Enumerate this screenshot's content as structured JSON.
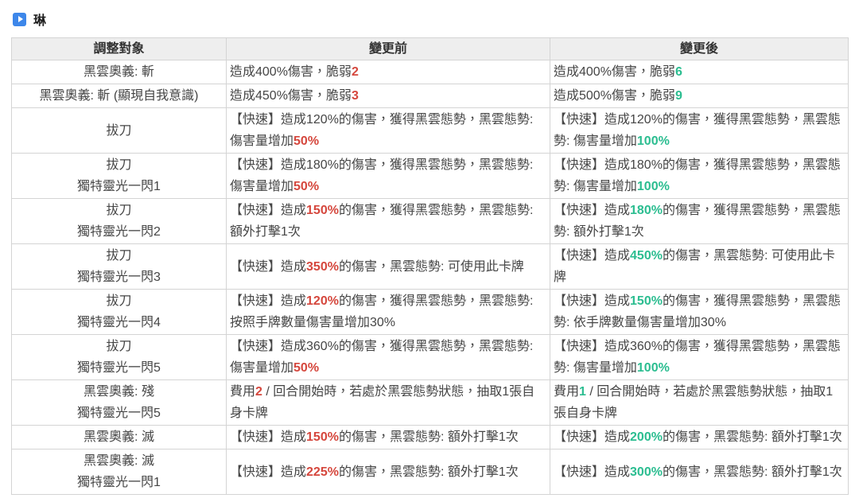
{
  "colors": {
    "accent_blue": "#3d87ea",
    "red": "#d5473d",
    "green": "#2bbd90",
    "header_bg": "#eeeeee",
    "border": "#d4d4d4"
  },
  "section": {
    "icon": "play-icon",
    "title": "琳"
  },
  "table": {
    "headers": [
      "調整對象",
      "變更前",
      "變更後"
    ],
    "rows": [
      {
        "target": [
          "黑雲奧義: 斬"
        ],
        "before": [
          {
            "t": "造成400%傷害，脆弱"
          },
          {
            "t": "2",
            "c": "red"
          }
        ],
        "after": [
          {
            "t": "造成400%傷害，脆弱"
          },
          {
            "t": "6",
            "c": "green"
          }
        ]
      },
      {
        "target": [
          "黑雲奧義: 斬 (顯現自我意識)"
        ],
        "before": [
          {
            "t": "造成450%傷害，脆弱"
          },
          {
            "t": "3",
            "c": "red"
          }
        ],
        "after": [
          {
            "t": "造成500%傷害，脆弱"
          },
          {
            "t": "9",
            "c": "green"
          }
        ]
      },
      {
        "target": [
          "拔刀"
        ],
        "before": [
          {
            "t": "【快速】造成120%的傷害，獲得黑雲態勢，黑雲態勢: 傷害量增加"
          },
          {
            "t": "50%",
            "c": "red"
          }
        ],
        "after": [
          {
            "t": "【快速】造成120%的傷害，獲得黑雲態勢，黑雲態勢: 傷害量增加"
          },
          {
            "t": "100%",
            "c": "green"
          }
        ]
      },
      {
        "target": [
          "拔刀",
          "獨特靈光一閃1"
        ],
        "before": [
          {
            "t": "【快速】造成180%的傷害，獲得黑雲態勢，黑雲態勢: 傷害量增加"
          },
          {
            "t": "50%",
            "c": "red"
          }
        ],
        "after": [
          {
            "t": "【快速】造成180%的傷害，獲得黑雲態勢，黑雲態勢: 傷害量增加"
          },
          {
            "t": "100%",
            "c": "green"
          }
        ]
      },
      {
        "target": [
          "拔刀",
          "獨特靈光一閃2"
        ],
        "before": [
          {
            "t": "【快速】造成"
          },
          {
            "t": "150%",
            "c": "red"
          },
          {
            "t": "的傷害，獲得黑雲態勢，黑雲態勢: 額外打擊1次"
          }
        ],
        "after": [
          {
            "t": "【快速】造成"
          },
          {
            "t": "180%",
            "c": "green"
          },
          {
            "t": "的傷害，獲得黑雲態勢，黑雲態勢: 額外打擊1次"
          }
        ]
      },
      {
        "target": [
          "拔刀",
          "獨特靈光一閃3"
        ],
        "before": [
          {
            "t": "【快速】造成"
          },
          {
            "t": "350%",
            "c": "red"
          },
          {
            "t": "的傷害，黑雲態勢: 可使用此卡牌"
          }
        ],
        "after": [
          {
            "t": "【快速】造成"
          },
          {
            "t": "450%",
            "c": "green"
          },
          {
            "t": "的傷害，黑雲態勢: 可使用此卡牌"
          }
        ]
      },
      {
        "target": [
          "拔刀",
          "獨特靈光一閃4"
        ],
        "before": [
          {
            "t": "【快速】造成"
          },
          {
            "t": "120%",
            "c": "red"
          },
          {
            "t": "的傷害，獲得黑雲態勢，黑雲態勢: 按照手牌數量傷害量增加30%"
          }
        ],
        "after": [
          {
            "t": "【快速】造成"
          },
          {
            "t": "150%",
            "c": "green"
          },
          {
            "t": "的傷害，獲得黑雲態勢，黑雲態勢: 依手牌數量傷害量增加30%"
          }
        ]
      },
      {
        "target": [
          "拔刀",
          "獨特靈光一閃5"
        ],
        "before": [
          {
            "t": "【快速】造成360%的傷害，獲得黑雲態勢，黑雲態勢: 傷害量增加"
          },
          {
            "t": "50%",
            "c": "red"
          }
        ],
        "after": [
          {
            "t": "【快速】造成360%的傷害，獲得黑雲態勢，黑雲態勢: 傷害量增加"
          },
          {
            "t": "100%",
            "c": "green"
          }
        ]
      },
      {
        "target": [
          "黑雲奧義: 殘",
          "獨特靈光一閃5"
        ],
        "before": [
          {
            "t": "費用"
          },
          {
            "t": "2",
            "c": "red"
          },
          {
            "t": " / 回合開始時，若處於黑雲態勢狀態，抽取1張自身卡牌"
          }
        ],
        "after": [
          {
            "t": "費用"
          },
          {
            "t": "1",
            "c": "green"
          },
          {
            "t": " / 回合開始時，若處於黑雲態勢狀態，抽取1張自身卡牌"
          }
        ]
      },
      {
        "target": [
          "黑雲奧義: 滅"
        ],
        "before": [
          {
            "t": "【快速】造成"
          },
          {
            "t": "150%",
            "c": "red"
          },
          {
            "t": "的傷害，黑雲態勢: 額外打擊1次"
          }
        ],
        "after": [
          {
            "t": "【快速】造成"
          },
          {
            "t": "200%",
            "c": "green"
          },
          {
            "t": "的傷害，黑雲態勢: 額外打擊1次"
          }
        ]
      },
      {
        "target": [
          "黑雲奧義: 滅",
          "獨特靈光一閃1"
        ],
        "before": [
          {
            "t": "【快速】造成"
          },
          {
            "t": "225%",
            "c": "red"
          },
          {
            "t": "的傷害，黑雲態勢: 額外打擊1次"
          }
        ],
        "after": [
          {
            "t": "【快速】造成"
          },
          {
            "t": "300%",
            "c": "green"
          },
          {
            "t": "的傷害，黑雲態勢: 額外打擊1次"
          }
        ]
      }
    ]
  }
}
